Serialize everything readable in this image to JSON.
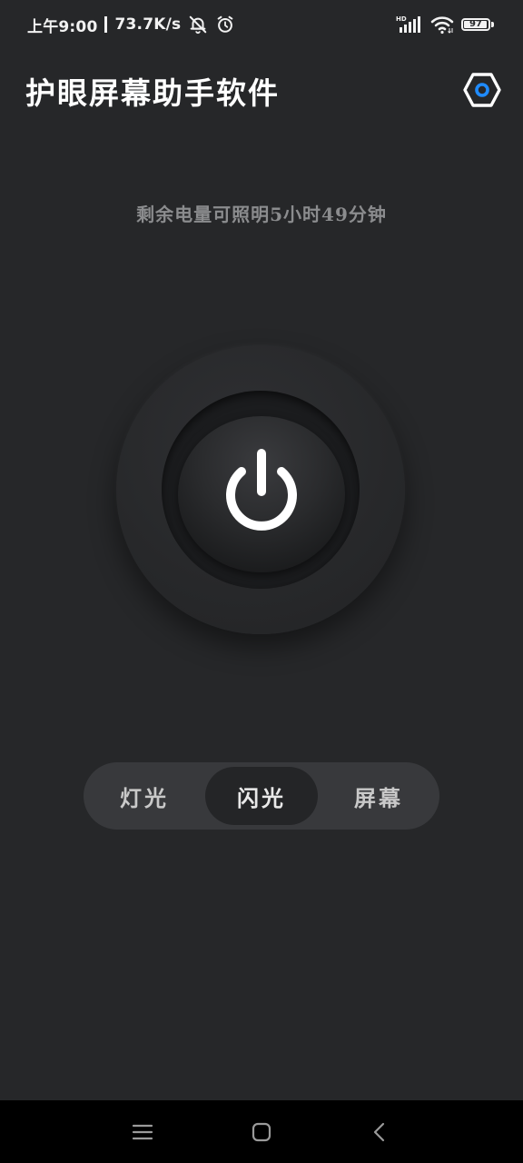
{
  "status_bar": {
    "time": "上午9:00",
    "net_speed": "73.7K/s",
    "network_badge": "HD",
    "battery_level": "97",
    "battery_fraction": 0.97,
    "icons": [
      "bell-off-icon",
      "alarm-icon",
      "signal-icon",
      "wifi-icon",
      "battery-icon"
    ]
  },
  "header": {
    "title": "护眼屏幕助手软件",
    "settings_icon": "settings-hex-icon",
    "accent_color": "#1f8bff"
  },
  "main": {
    "remaining_text": "剩余电量可照明5小时49分钟",
    "power_icon": "power-icon"
  },
  "modes": {
    "tabs": [
      {
        "label": "灯光",
        "active": false
      },
      {
        "label": "闪光",
        "active": true
      },
      {
        "label": "屏幕",
        "active": false
      }
    ]
  },
  "nav_bar": {
    "icons": [
      "menu-icon",
      "home-icon",
      "back-icon"
    ]
  },
  "colors": {
    "background": "#262729",
    "text_muted": "#8b8c8e",
    "nav_background": "#000000"
  }
}
